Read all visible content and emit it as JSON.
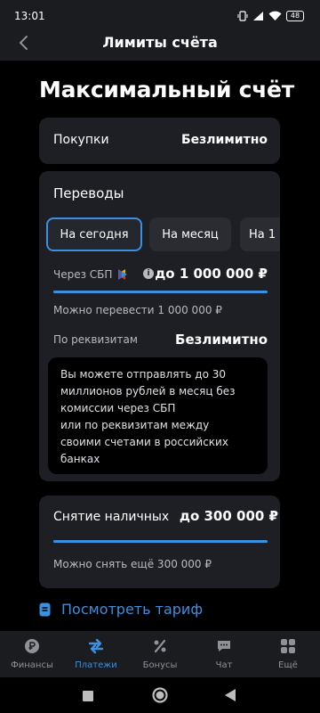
{
  "status": {
    "time": "13:01",
    "battery": "48"
  },
  "header": {
    "title": "Лимиты счёта"
  },
  "page": {
    "title": "Максимальный счёт"
  },
  "purchases": {
    "label": "Покупки",
    "value": "Безлимитно"
  },
  "transfers": {
    "title": "Переводы",
    "tabs": [
      {
        "label": "На сегодня",
        "active": true
      },
      {
        "label": "На месяц",
        "active": false
      },
      {
        "label": "На 1",
        "active": false
      }
    ],
    "sbp_label": "Через СБП",
    "sbp_value": "до 1 000 000 ₽",
    "sbp_progress": 1.0,
    "sbp_remaining": "Можно перевести 1 000 000 ₽",
    "requisites_label": "По реквизитам",
    "requisites_value": "Безлимитно",
    "tooltip_lines": [
      "Вы можете отправлять до 30",
      "миллионов рублей в месяц без",
      "комиссии через СБП",
      "или по реквизитам между",
      "своими счетами в российских",
      "банках"
    ]
  },
  "withdrawal": {
    "label": "Снятие наличных",
    "value": "до 300 000 ₽",
    "progress": 1.0,
    "remaining": "Можно снять ещё 300 000 ₽"
  },
  "tariff_link": "Посмотреть тариф",
  "nav": [
    {
      "label": "Финансы",
      "icon": "ruble-icon",
      "active": false
    },
    {
      "label": "Платежи",
      "icon": "transfer-arrows-icon",
      "active": true
    },
    {
      "label": "Бонусы",
      "icon": "percent-icon",
      "active": false
    },
    {
      "label": "Чат",
      "icon": "chat-icon",
      "active": false
    },
    {
      "label": "Ещё",
      "icon": "grid-icon",
      "active": false
    }
  ],
  "colors": {
    "accent": "#3d8fe0",
    "card": "#1d1f24",
    "background": "#000000"
  }
}
